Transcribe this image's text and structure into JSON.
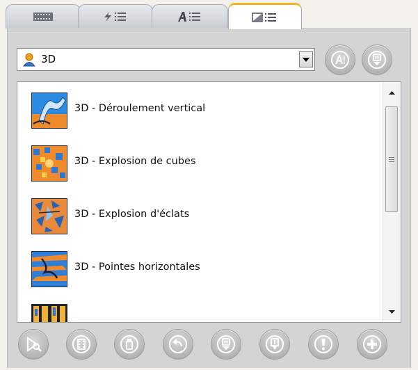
{
  "tabs": [
    {
      "name": "timeline-tab-icon",
      "active": false
    },
    {
      "name": "effects-list-tab-icon",
      "active": false
    },
    {
      "name": "text-list-tab-icon",
      "active": false
    },
    {
      "name": "transitions-list-tab-icon",
      "active": true
    }
  ],
  "category_select": {
    "icon": "person-icon",
    "value": "3D"
  },
  "header_buttons": [
    {
      "icon": "text-style-icon"
    },
    {
      "icon": "download-icon"
    }
  ],
  "transitions": [
    {
      "label": "3D - Déroulement vertical"
    },
    {
      "label": "3D - Explosion de cubes"
    },
    {
      "label": "3D - Explosion d'éclats"
    },
    {
      "label": "3D - Pointes horizontales"
    },
    {
      "label": ""
    }
  ],
  "toolbar": [
    {
      "icon": "preview-search-icon"
    },
    {
      "icon": "film-icon"
    },
    {
      "icon": "clip-icon"
    },
    {
      "icon": "undo-icon"
    },
    {
      "icon": "download-icon"
    },
    {
      "icon": "import-icon"
    },
    {
      "icon": "alert-icon"
    },
    {
      "icon": "add-icon"
    }
  ],
  "colors": {
    "active_tab_accent": "#f5b324",
    "button_gray": "#bdbdbd",
    "list_border": "#8e97a3"
  }
}
